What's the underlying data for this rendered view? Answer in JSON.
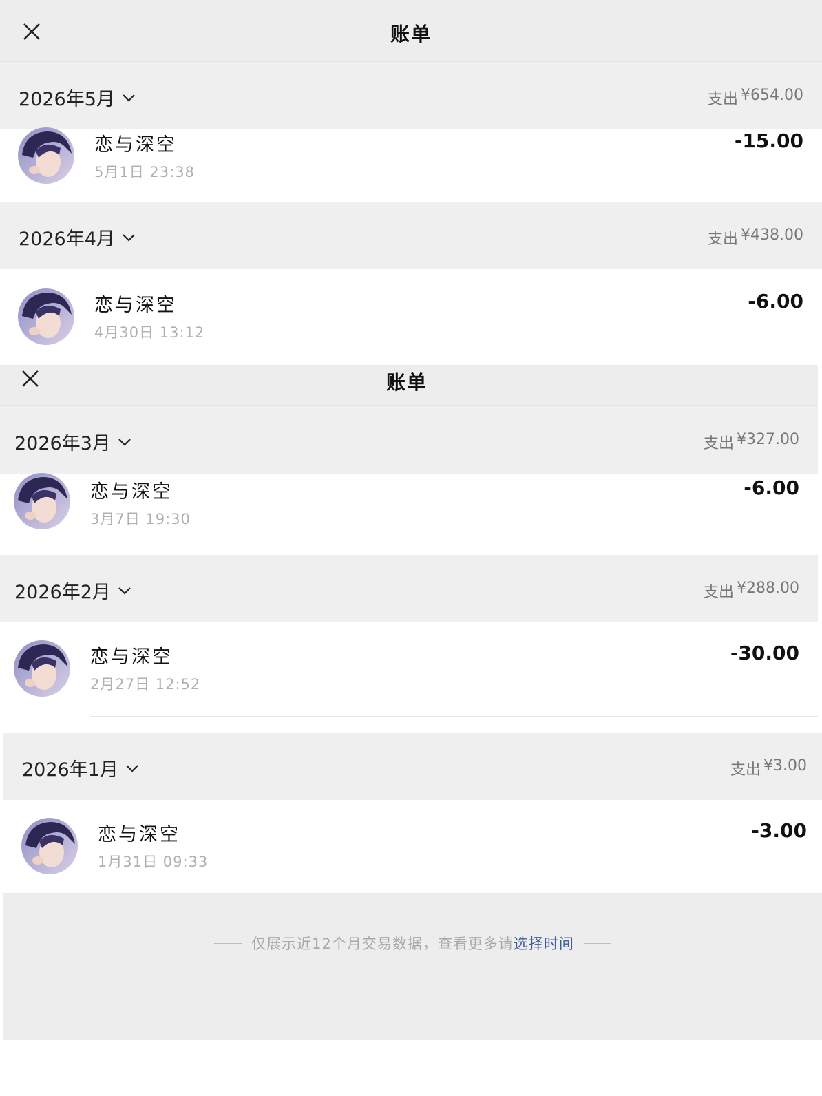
{
  "header": {
    "title": "账单"
  },
  "months": [
    {
      "label": "2026年5月",
      "spend_label": "支出",
      "spend_amount": "¥654.00",
      "txn": {
        "name": "恋与深空",
        "time": "5月1日 23:38",
        "amount": "-15.00"
      }
    },
    {
      "label": "2026年4月",
      "spend_label": "支出",
      "spend_amount": "¥438.00",
      "txn": {
        "name": "恋与深空",
        "time": "4月30日 13:12",
        "amount": "-6.00"
      }
    },
    {
      "label": "2026年3月",
      "spend_label": "支出",
      "spend_amount": "¥327.00",
      "txn": {
        "name": "恋与深空",
        "time": "3月7日 19:30",
        "amount": "-6.00"
      }
    },
    {
      "label": "2026年2月",
      "spend_label": "支出",
      "spend_amount": "¥288.00",
      "txn": {
        "name": "恋与深空",
        "time": "2月27日 12:52",
        "amount": "-30.00"
      }
    },
    {
      "label": "2026年1月",
      "spend_label": "支出",
      "spend_amount": "¥3.00",
      "txn": {
        "name": "恋与深空",
        "time": "1月31日 09:33",
        "amount": "-3.00"
      }
    }
  ],
  "footer": {
    "note": "仅展示近12个月交易数据，查看更多请",
    "link": "选择时间"
  },
  "icons": {
    "close": "close-icon",
    "chevron": "chevron-down-icon",
    "avatar": "avatar-image"
  }
}
